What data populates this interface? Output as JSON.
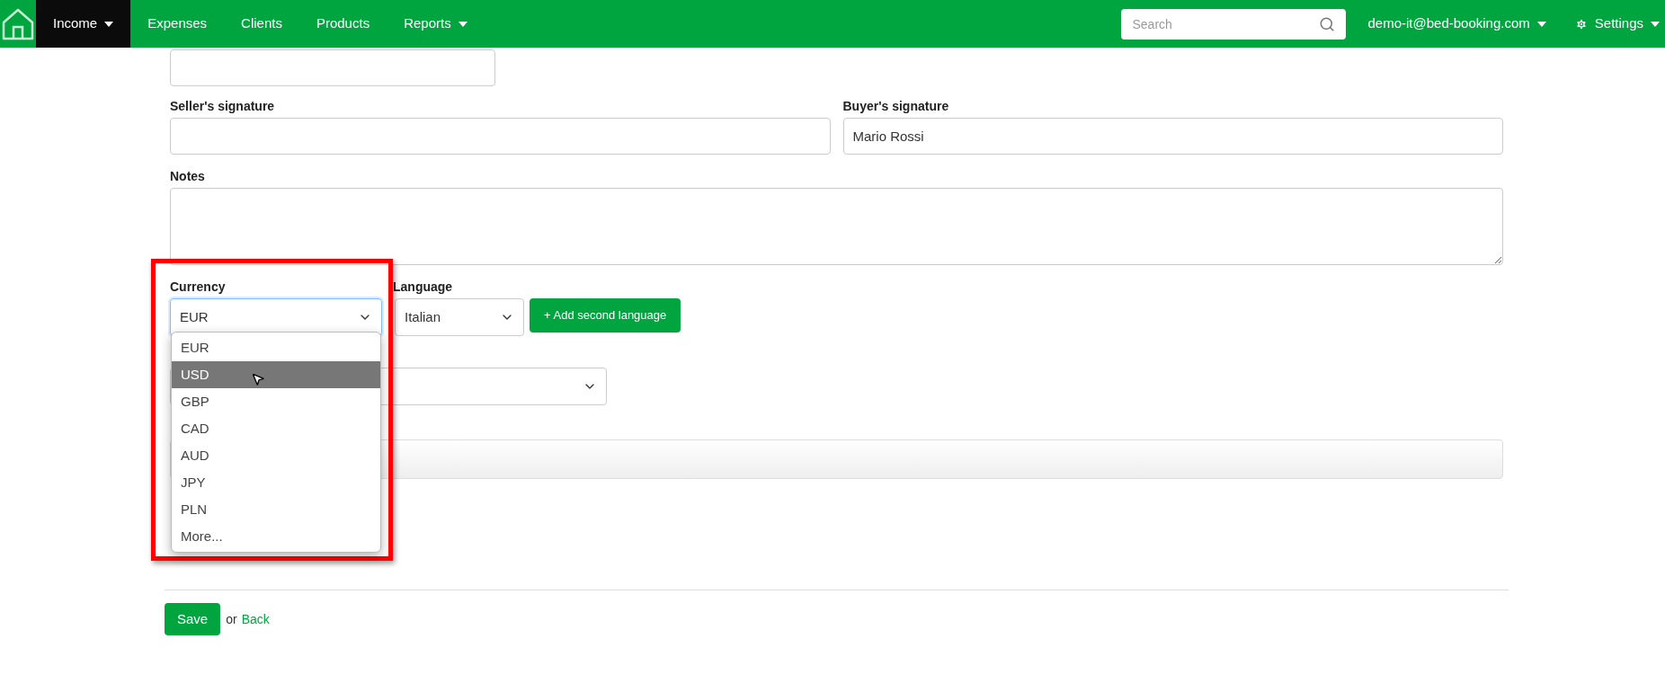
{
  "navbar": {
    "items": [
      {
        "label": "Income",
        "selected": true,
        "caret": true
      },
      {
        "label": "Expenses",
        "selected": false,
        "caret": false
      },
      {
        "label": "Clients",
        "selected": false,
        "caret": false
      },
      {
        "label": "Products",
        "selected": false,
        "caret": false
      },
      {
        "label": "Reports",
        "selected": false,
        "caret": true
      }
    ],
    "search": {
      "placeholder": "Search"
    },
    "user": "demo-it@bed-booking.com",
    "settings": "Settings"
  },
  "form": {
    "seller_signature": {
      "label": "Seller's signature"
    },
    "buyer_signature": {
      "label": "Buyer's signature",
      "value": "Mario Rossi"
    },
    "notes": {
      "label": "Notes"
    },
    "currency": {
      "label": "Currency",
      "value": "EUR",
      "highlighted": true,
      "expanded": true,
      "options": [
        {
          "label": "EUR",
          "hovered": false
        },
        {
          "label": "USD",
          "hovered": true
        },
        {
          "label": "GBP",
          "hovered": false
        },
        {
          "label": "CAD",
          "hovered": false
        },
        {
          "label": "AUD",
          "hovered": false
        },
        {
          "label": "JPY",
          "hovered": false
        },
        {
          "label": "PLN",
          "hovered": false
        },
        {
          "label": "More...",
          "hovered": false
        }
      ]
    },
    "language": {
      "label": "Language",
      "value": "Italian"
    },
    "add_language_button": "+ Add second language"
  },
  "actions": {
    "save": "Save",
    "or": "or",
    "back": "Back"
  }
}
